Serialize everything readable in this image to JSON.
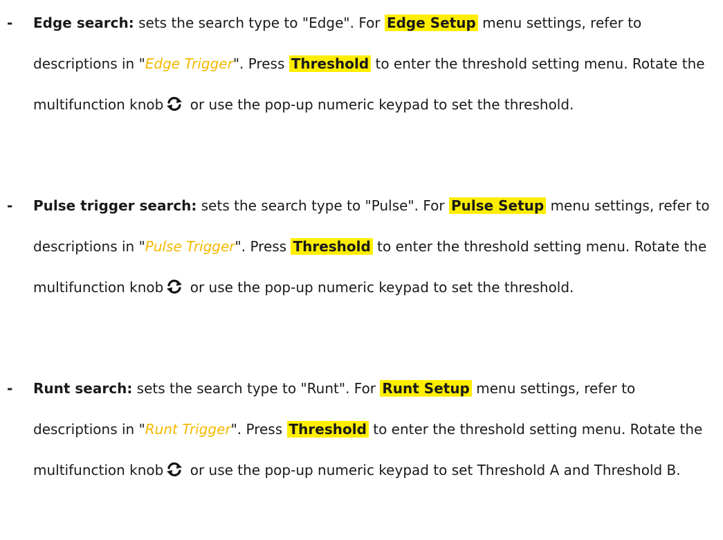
{
  "items": [
    {
      "bullet": "-",
      "term": "Edge search:",
      "t1": " sets the search type to \"Edge\". For ",
      "key1": "Edge Setup",
      "t2": " menu settings, refer to descriptions in \"",
      "xref": "Edge Trigger",
      "t3": "\". Press ",
      "key2": "Threshold",
      "t4": " to enter the threshold setting menu. Rotate the multifunction knob",
      "t5": " or use the pop-up numeric keypad to set the threshold."
    },
    {
      "bullet": "-",
      "term": "Pulse trigger search:",
      "t1": " sets the search type to \"Pulse\". For ",
      "key1": "Pulse Setup",
      "t2": " menu settings, refer to descriptions in \"",
      "xref": "Pulse Trigger",
      "t3": "\". Press ",
      "key2": "Threshold",
      "t4": " to enter the threshold setting menu. Rotate the multifunction knob",
      "t5": " or use the pop-up numeric keypad to set the threshold."
    },
    {
      "bullet": "-",
      "term": "Runt search:",
      "t1": " sets the search type to \"Runt\". For ",
      "key1": "Runt Setup",
      "t2": " menu settings, refer to descriptions in \"",
      "xref": "Runt Trigger",
      "t3": "\". Press ",
      "key2": "Threshold",
      "t4": " to enter the threshold setting menu. Rotate the multifunction knob",
      "t5": " or use the pop-up numeric keypad to set Threshold A and Threshold B."
    }
  ],
  "icons": {
    "knob": "multifunction-knob-rotate-icon"
  },
  "colors": {
    "key_highlight": "#ffee00",
    "xref_text": "#f5b800"
  }
}
